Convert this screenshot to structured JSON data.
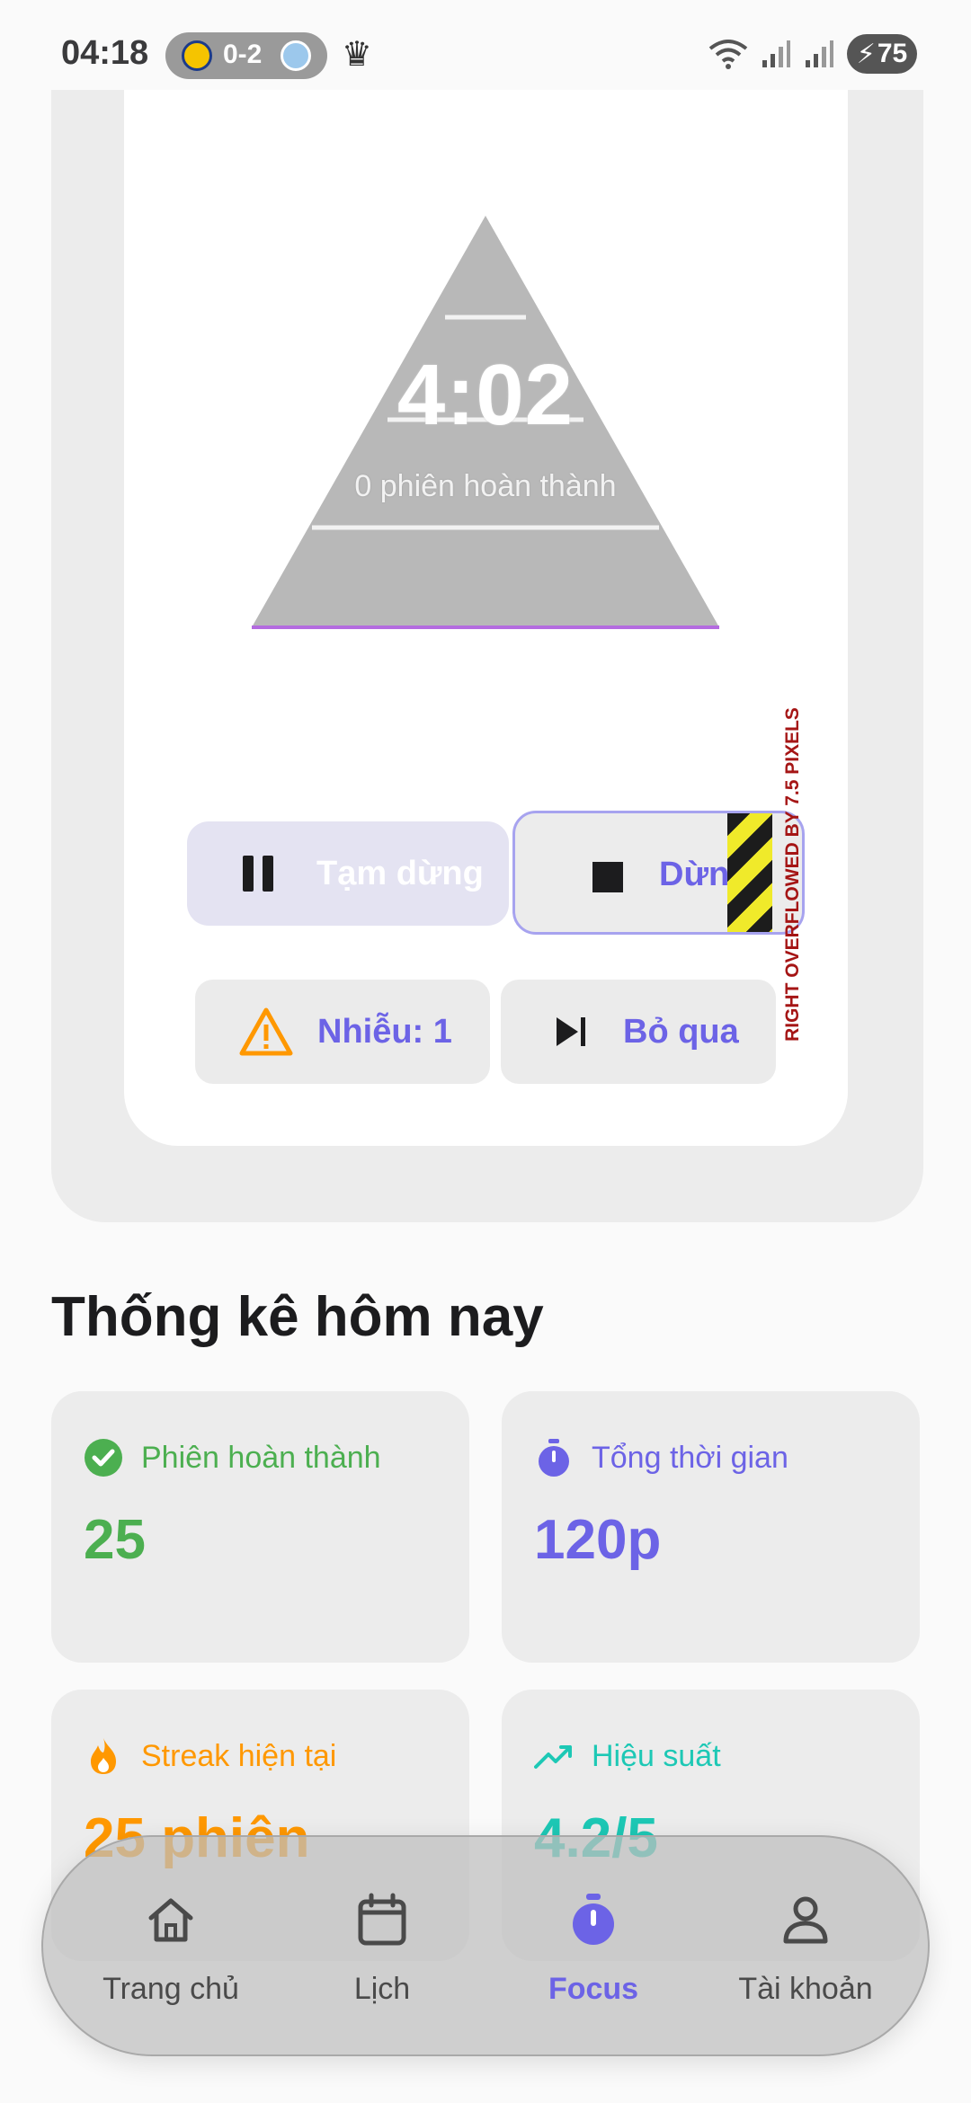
{
  "status_bar": {
    "time": "04:18",
    "score": "0-2",
    "battery": "75"
  },
  "timer": {
    "time": "4:02",
    "sessions_done": "0 phiên hoàn thành"
  },
  "controls": {
    "pause_label": "Tạm dừng",
    "stop_label": "Dừng",
    "noise_label": "Nhiễu: 1",
    "skip_label": "Bỏ qua",
    "overflow_warning": "RIGHT OVERFLOWED BY 7.5 PIXELS"
  },
  "stats": {
    "title": "Thống kê hôm nay",
    "completed": {
      "label": "Phiên hoàn thành",
      "value": "25",
      "icon": "check-circle-icon",
      "color": "#4caf50"
    },
    "total_time": {
      "label": "Tổng thời gian",
      "value": "120p",
      "icon": "stopwatch-icon",
      "color": "#6c63e6"
    },
    "streak": {
      "label": "Streak hiện tại",
      "value": "25 phiên",
      "icon": "fire-icon",
      "color": "#ff9800"
    },
    "performance": {
      "label": "Hiệu suất",
      "value": "4.2/5",
      "icon": "trending-up-icon",
      "color": "#1dc8b5"
    }
  },
  "nav": {
    "items": [
      {
        "label": "Trang chủ",
        "icon": "home-icon",
        "active": false
      },
      {
        "label": "Lịch",
        "icon": "calendar-icon",
        "active": false
      },
      {
        "label": "Focus",
        "icon": "stopwatch-icon",
        "active": true
      },
      {
        "label": "Tài khoản",
        "icon": "person-icon",
        "active": false
      }
    ]
  },
  "colors": {
    "accent": "#6c63e6",
    "pyramid": "#b8b8b8"
  }
}
